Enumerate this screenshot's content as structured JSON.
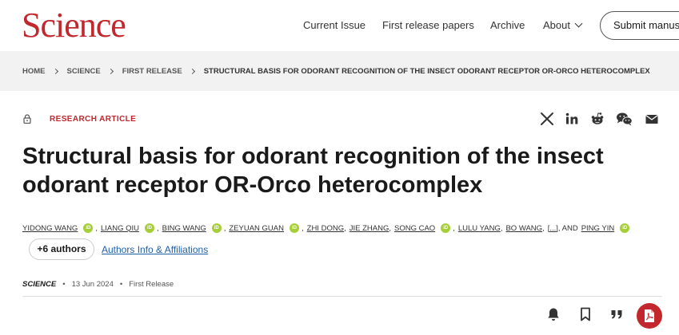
{
  "brand": {
    "logo": "Science",
    "accent": "#c1272d"
  },
  "nav": {
    "items": [
      "Current Issue",
      "First release papers",
      "Archive",
      "About"
    ],
    "submit_label": "Submit manuscript"
  },
  "breadcrumb": [
    "HOME",
    "SCIENCE",
    "FIRST RELEASE",
    "STRUCTURAL BASIS FOR ODORANT RECOGNITION OF THE INSECT ODORANT RECEPTOR OR-ORCO HETEROCOMPLEX"
  ],
  "article": {
    "type": "RESEARCH ARTICLE",
    "title": "Structural basis for odorant recognition of the insect odorant receptor OR-Orco heterocomplex",
    "authors": [
      {
        "name": "YIDONG WANG",
        "orcid": true,
        "sep": ","
      },
      {
        "name": "LIANG QIU",
        "orcid": true,
        "sep": ","
      },
      {
        "name": "BING WANG",
        "orcid": true,
        "sep": ","
      },
      {
        "name": "ZEYUAN GUAN",
        "orcid": true,
        "sep": ","
      },
      {
        "name": "ZHI DONG",
        "orcid": false,
        "sep": ","
      },
      {
        "name": "JIE ZHANG",
        "orcid": false,
        "sep": ","
      },
      {
        "name": "SONG CAO",
        "orcid": true,
        "sep": ","
      },
      {
        "name": "LULU YANG",
        "orcid": false,
        "sep": ","
      },
      {
        "name": "BO WANG",
        "orcid": false,
        "sep": ","
      },
      {
        "name": "[...]",
        "orcid": false,
        "sep": ", AND"
      },
      {
        "name": "PING YIN",
        "orcid": true,
        "sep": ""
      }
    ],
    "orcid_label": "iD",
    "more_authors_label": "+6 authors",
    "affiliations_link": "Authors Info & Affiliations",
    "journal": "SCIENCE",
    "date": "13 Jun 2024",
    "status": "First Release",
    "pubrow_dot": "•"
  },
  "share_icons": [
    "x-icon",
    "linkedin-icon",
    "reddit-icon",
    "wechat-icon",
    "email-icon"
  ],
  "tool_icons": [
    "bell-icon",
    "bookmark-icon",
    "quote-icon",
    "pdf-icon"
  ]
}
